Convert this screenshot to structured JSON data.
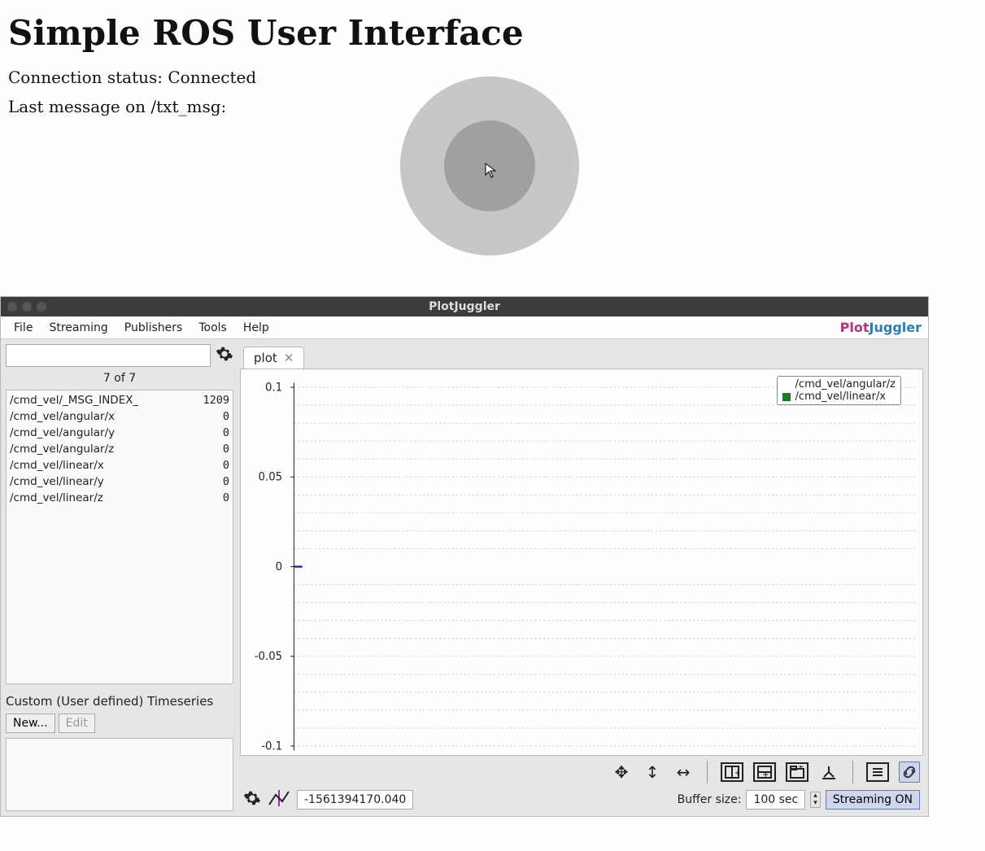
{
  "ros": {
    "title": "Simple ROS User Interface",
    "conn_label": "Connection status: ",
    "conn_value": "Connected",
    "lastmsg_label": "Last message on /txt_msg:",
    "lastmsg_value": ""
  },
  "pj": {
    "window_title": "PlotJuggler",
    "menus": {
      "file": "File",
      "streaming": "Streaming",
      "publishers": "Publishers",
      "tools": "Tools",
      "help": "Help"
    },
    "logo": {
      "plot": "Plot",
      "juggler": "Juggler"
    },
    "side": {
      "count": "7 of 7",
      "topics": [
        {
          "name": "/cmd_vel/_MSG_INDEX_",
          "value": "1209"
        },
        {
          "name": "/cmd_vel/angular/x",
          "value": "0"
        },
        {
          "name": "/cmd_vel/angular/y",
          "value": "0"
        },
        {
          "name": "/cmd_vel/angular/z",
          "value": "0"
        },
        {
          "name": "/cmd_vel/linear/x",
          "value": "0"
        },
        {
          "name": "/cmd_vel/linear/y",
          "value": "0"
        },
        {
          "name": "/cmd_vel/linear/z",
          "value": "0"
        }
      ],
      "custom_label": "Custom (User defined) Timeseries",
      "new_btn": "New...",
      "edit_btn": "Edit"
    },
    "tab": {
      "label": "plot"
    },
    "axis": {
      "ymax": "0.1",
      "y1": "0.05",
      "y0": "0",
      "ym1": "-0.05",
      "ymin": "-0.1"
    },
    "legend": {
      "s1": {
        "name": "/cmd_vel/angular/z",
        "color": "#1020c0"
      },
      "s2": {
        "name": "/cmd_vel/linear/x",
        "color": "#108020"
      }
    },
    "status": {
      "time_value": "-1561394170.040",
      "buffer_label": "Buffer size:",
      "buffer_value": "100 sec",
      "stream_btn": "Streaming ON"
    }
  },
  "chart_data": {
    "type": "line",
    "title": "plot",
    "xlabel": "",
    "ylabel": "",
    "ylim": [
      -0.1,
      0.1
    ],
    "x": [],
    "series": [
      {
        "name": "/cmd_vel/angular/z",
        "color": "#1020c0",
        "values": []
      },
      {
        "name": "/cmd_vel/linear/x",
        "color": "#108020",
        "values": []
      }
    ],
    "note": "Both series flat at 0"
  }
}
